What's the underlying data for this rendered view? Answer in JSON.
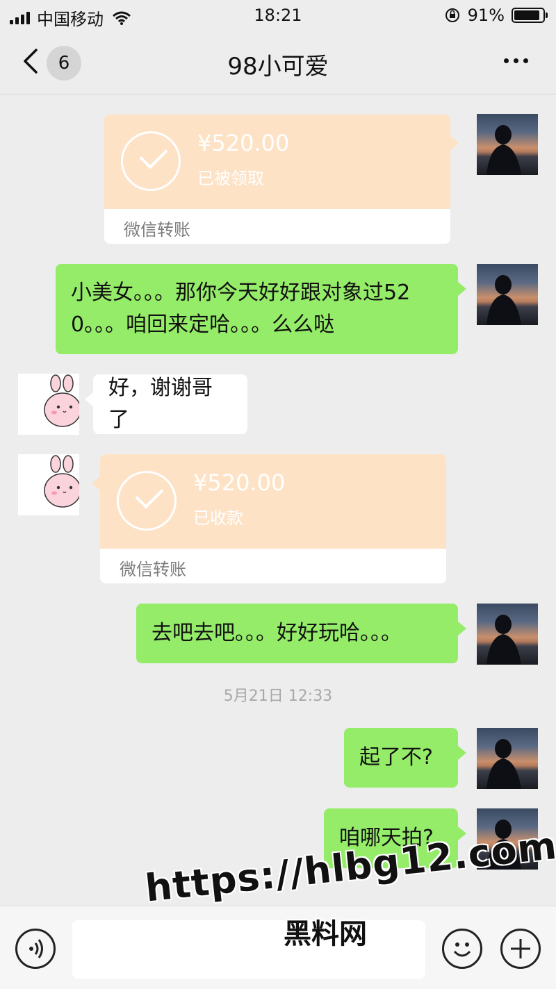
{
  "status_bar": {
    "carrier": "中国移动",
    "time": "18:21",
    "battery": "91%",
    "battery_level": 0.91
  },
  "header": {
    "back_badge": "6",
    "title": "98小可爱"
  },
  "messages": [
    {
      "type": "transfer",
      "side": "right",
      "amount": "¥520.00",
      "status": "已被领取",
      "label": "微信转账"
    },
    {
      "type": "text",
      "side": "right",
      "text": "小美女。。。那你今天好好跟对象过520。。。咱回来定哈。。。么么哒"
    },
    {
      "type": "text",
      "side": "left",
      "text": "好，谢谢哥了"
    },
    {
      "type": "transfer",
      "side": "left",
      "amount": "¥520.00",
      "status": "已收款",
      "label": "微信转账"
    },
    {
      "type": "text",
      "side": "right",
      "text": "去吧去吧。。。好好玩哈。。。"
    },
    {
      "type": "text",
      "side": "right",
      "text": "起了不?"
    },
    {
      "type": "text",
      "side": "right",
      "text": "咱哪天拍?"
    }
  ],
  "timestamp": "5月21日 12:33",
  "input_bar": {
    "icons": [
      "voice-icon",
      "emoji-icon",
      "plus-icon"
    ],
    "input_value": ""
  },
  "watermark": {
    "url": "https://hlbg12.com",
    "name": "黑料网"
  }
}
